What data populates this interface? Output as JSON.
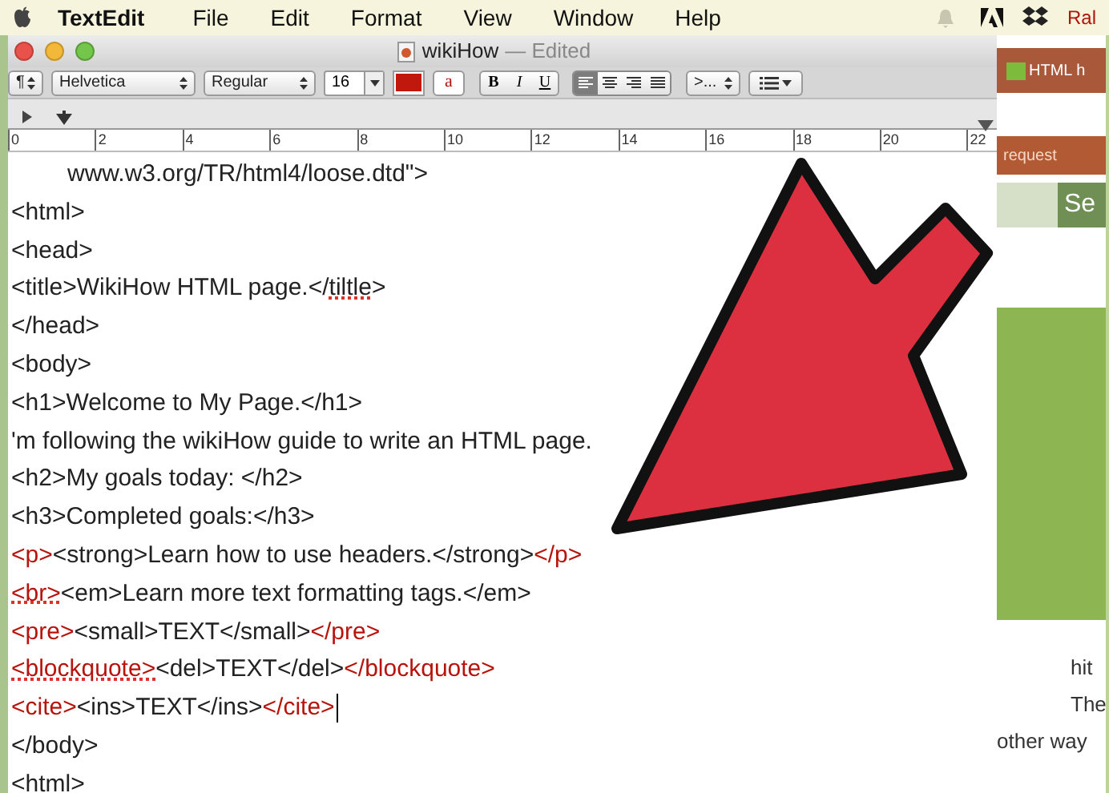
{
  "menu_bar": {
    "app": "TextEdit",
    "items": [
      "File",
      "Edit",
      "Format",
      "View",
      "Window",
      "Help"
    ],
    "user": "Ral"
  },
  "window": {
    "title": "wikiHow",
    "status": "— Edited"
  },
  "toolbar": {
    "paragraph": "¶",
    "font": "Helvetica",
    "typeface": "Regular",
    "size": "16",
    "background_letter": "a",
    "style_buttons": [
      "B",
      "I",
      "U"
    ],
    "alignments": [
      {
        "selected": true
      },
      {
        "selected": false
      },
      {
        "selected": false
      },
      {
        "selected": false
      }
    ],
    "spacing": ">..."
  },
  "ruler": {
    "labels": [
      "0",
      "2",
      "4",
      "6",
      "8",
      "10",
      "12",
      "14",
      "16",
      "18",
      "20",
      "22"
    ]
  },
  "document": {
    "lines": [
      {
        "indented": true,
        "cursor": false,
        "segments": [
          {
            "text": "www.w3.org/TR/html4/loose.dtd\">",
            "highlighted": false,
            "misspelled": false
          }
        ]
      },
      {
        "indented": false,
        "cursor": false,
        "segments": [
          {
            "text": "<html>",
            "highlighted": false,
            "misspelled": false
          }
        ]
      },
      {
        "indented": false,
        "cursor": false,
        "segments": [
          {
            "text": "<head>",
            "highlighted": false,
            "misspelled": false
          }
        ]
      },
      {
        "indented": false,
        "cursor": false,
        "segments": [
          {
            "text": "<title>WikiHow HTML page.</",
            "highlighted": false,
            "misspelled": false
          },
          {
            "text": "tiltle",
            "highlighted": false,
            "misspelled": true
          },
          {
            "text": ">",
            "highlighted": false,
            "misspelled": false
          }
        ]
      },
      {
        "indented": false,
        "cursor": false,
        "segments": [
          {
            "text": "</head>",
            "highlighted": false,
            "misspelled": false
          }
        ]
      },
      {
        "indented": false,
        "cursor": false,
        "segments": [
          {
            "text": "<body>",
            "highlighted": false,
            "misspelled": false
          }
        ]
      },
      {
        "indented": false,
        "cursor": false,
        "segments": [
          {
            "text": "<h1>Welcome to My Page.</h1>",
            "highlighted": false,
            "misspelled": false
          }
        ]
      },
      {
        "indented": false,
        "cursor": false,
        "segments": [
          {
            "text": "'m following the wikiHow guide to write an HTML page.",
            "highlighted": false,
            "misspelled": false
          }
        ]
      },
      {
        "indented": false,
        "cursor": false,
        "segments": [
          {
            "text": "<h2>My goals today: </h2>",
            "highlighted": false,
            "misspelled": false
          }
        ]
      },
      {
        "indented": false,
        "cursor": false,
        "segments": [
          {
            "text": "<h3>Completed goals:</h3>",
            "highlighted": false,
            "misspelled": false
          }
        ]
      },
      {
        "indented": false,
        "cursor": false,
        "segments": [
          {
            "text": "<p>",
            "highlighted": true,
            "misspelled": false
          },
          {
            "text": "<strong>Learn how to use headers.</strong>",
            "highlighted": false,
            "misspelled": false
          },
          {
            "text": "</p>",
            "highlighted": true,
            "misspelled": false
          }
        ]
      },
      {
        "indented": false,
        "cursor": false,
        "segments": [
          {
            "text": "<br>",
            "highlighted": true,
            "misspelled": true
          },
          {
            "text": "<em>Learn more text formatting tags.</em>",
            "highlighted": false,
            "misspelled": false
          }
        ]
      },
      {
        "indented": false,
        "cursor": false,
        "segments": [
          {
            "text": "<pre>",
            "highlighted": true,
            "misspelled": false
          },
          {
            "text": "<small>TEXT</small>",
            "highlighted": false,
            "misspelled": false
          },
          {
            "text": "</pre>",
            "highlighted": true,
            "misspelled": false
          }
        ]
      },
      {
        "indented": false,
        "cursor": false,
        "segments": [
          {
            "text": "<blockquote>",
            "highlighted": true,
            "misspelled": true
          },
          {
            "text": "<del>TEXT</del>",
            "highlighted": false,
            "misspelled": false
          },
          {
            "text": "</blockquote>",
            "highlighted": true,
            "misspelled": false
          }
        ]
      },
      {
        "indented": false,
        "cursor": true,
        "segments": [
          {
            "text": "<cite>",
            "highlighted": true,
            "misspelled": false
          },
          {
            "text": "<ins>TEXT</ins>",
            "highlighted": false,
            "misspelled": false
          },
          {
            "text": "</cite>",
            "highlighted": true,
            "misspelled": false
          }
        ]
      },
      {
        "indented": false,
        "cursor": false,
        "segments": [
          {
            "text": "</body>",
            "highlighted": false,
            "misspelled": false
          }
        ]
      },
      {
        "indented": false,
        "cursor": false,
        "segments": [
          {
            "text": "<html>",
            "highlighted": false,
            "misspelled": false
          }
        ]
      }
    ]
  },
  "background_page": {
    "tab": "HTML h",
    "bar_text": "request",
    "button": "Se",
    "texts": [
      "hit",
      "The",
      "other way"
    ]
  }
}
